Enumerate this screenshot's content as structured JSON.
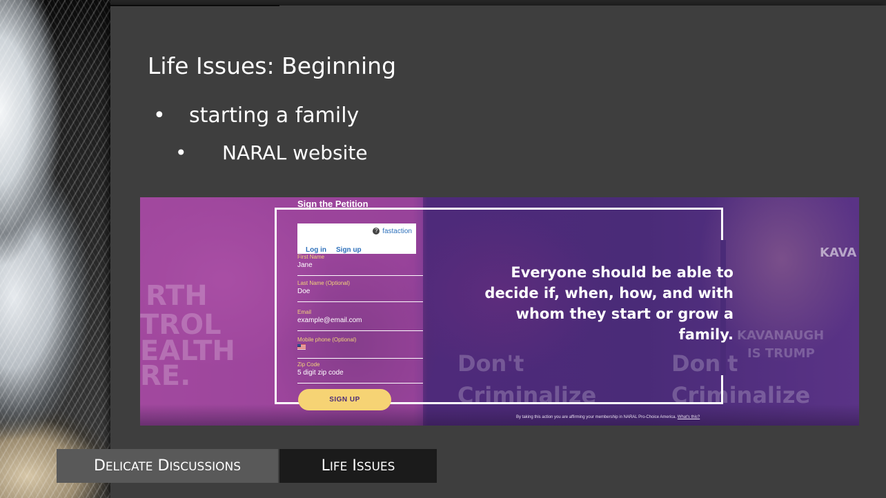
{
  "slide": {
    "title": "Life Issues: Beginning",
    "bullets": [
      {
        "marker": "•",
        "text": "starting a family"
      },
      {
        "marker": "•",
        "text": "NARAL website"
      }
    ]
  },
  "screenshot": {
    "form_title": "Sign the Petition",
    "fastaction": {
      "logo_text": "fastaction",
      "login_label": "Log in",
      "signup_label": "Sign up"
    },
    "fields": [
      {
        "label": "First Name",
        "value": "Jane"
      },
      {
        "label": "Last Name (Optional)",
        "value": "Doe"
      },
      {
        "label": "Email",
        "value": "example@email.com"
      },
      {
        "label": "Mobile phone (Optional)",
        "value": ""
      },
      {
        "label": "Zip Code",
        "value": "5 digit zip code"
      }
    ],
    "signup_button": "SIGN UP",
    "headline": "Everyone should be able to decide if, when, how, and with whom they start or grow a family.",
    "disclaimer_text": "By taking this action you are affirming your membership in NARAL Pro-Choice America.",
    "disclaimer_link": "What's this?",
    "background_signs": [
      "RTH",
      "TROL",
      "EALTH",
      "RE.",
      "Don't",
      "Criminalize",
      "Don't",
      "Criminalize",
      "KAVANAUGH",
      "IS TRUMP",
      "KAVA"
    ],
    "colors": {
      "accent_yellow": "#f6d374",
      "purple": "#4a2b78",
      "link_blue": "#2c6fba"
    }
  },
  "footer": {
    "left_label": "Delicate Discussions",
    "right_label": "Life Issues"
  }
}
